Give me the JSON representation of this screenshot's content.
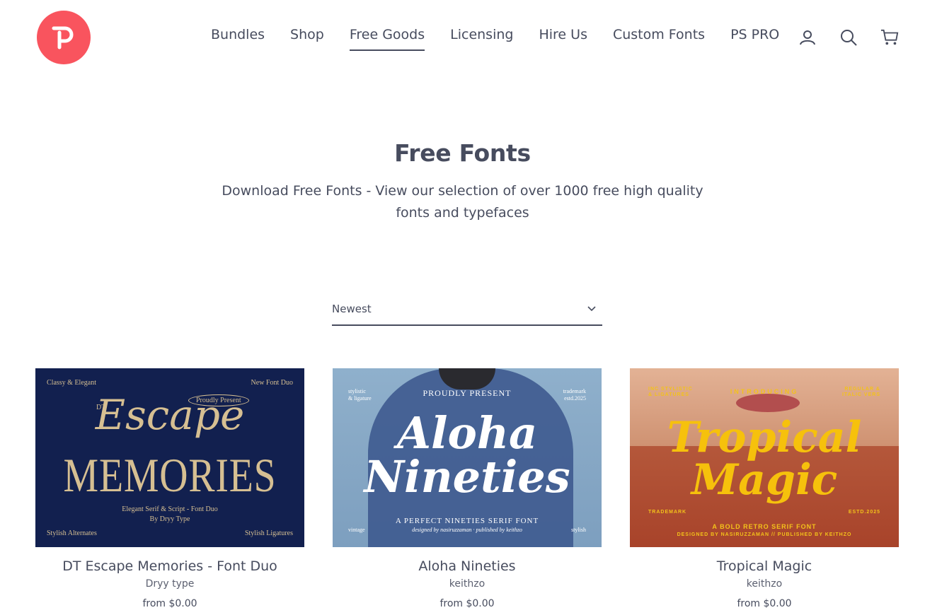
{
  "nav": {
    "items": [
      {
        "label": "Bundles"
      },
      {
        "label": "Shop"
      },
      {
        "label": "Free Goods"
      },
      {
        "label": "Licensing"
      },
      {
        "label": "Hire Us"
      },
      {
        "label": "Custom Fonts"
      },
      {
        "label": "PS PRO"
      }
    ],
    "active": "Free Goods",
    "icons": [
      "account-icon",
      "search-icon",
      "cart-icon"
    ]
  },
  "brand": {
    "logo_color": "#f9545e"
  },
  "hero": {
    "title": "Free Fonts",
    "description": "Download Free Fonts - View our selection of over 1000 free high quality fonts and typefaces"
  },
  "sort": {
    "selected": "Newest"
  },
  "products": [
    {
      "title": "DT Escape Memories - Font Duo",
      "vendor": "Dryy type",
      "price": "from $0.00",
      "image": {
        "top_left": "Classy & Elegant",
        "top_right": "New Font Duo",
        "prefix": "DT",
        "badge": "Proudly Present",
        "script": "Escape",
        "headline": "MEMORIES",
        "line1": "Elegant Serif & Script - Font Duo",
        "line2": "By Dryy Type",
        "bottom_left": "Stylish Alternates",
        "bottom_right": "Stylish Ligatures"
      }
    },
    {
      "title": "Aloha Nineties",
      "vendor": "keithzo",
      "price": "from $0.00",
      "image": {
        "top_left_1": "stylistic",
        "top_left_2": "& ligature",
        "top_center": "PROUDLY PRESENT",
        "top_right_1": "trademark",
        "top_right_2": "estd.2025",
        "line_a": "Aloha",
        "line_b": "Nineties",
        "tagline": "A PERFECT NINETIES SERIF FONT",
        "credits": "designed by nasiruzzaman · published by keithzo",
        "bottom_left": "vintage",
        "bottom_right": "stylish"
      }
    },
    {
      "title": "Tropical Magic",
      "vendor": "keithzo",
      "price": "from $0.00",
      "image": {
        "top_left_1": "INC STYLISTIC",
        "top_left_2": "& LIGATURES",
        "top_center": "INTRODUCING",
        "top_right_1": "REGULAR &",
        "top_right_2": "ITALIC VERS",
        "line_a": "Tropical",
        "line_b": "Magic",
        "left_mid": "TRADEMARK",
        "right_mid": "ESTD.2025",
        "tagline": "A BOLD RETRO SERIF FONT",
        "credits": "DESIGNED BY NASIRUZZAMAN // PUBLISHED BY KEITHZO"
      }
    }
  ]
}
